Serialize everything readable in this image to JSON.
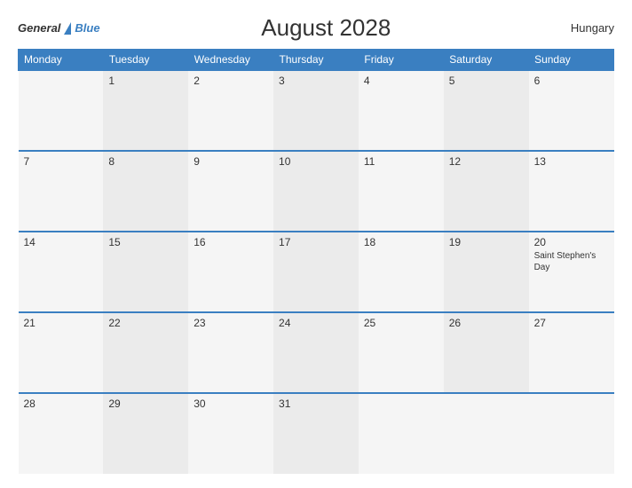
{
  "header": {
    "logo_general": "General",
    "logo_blue": "Blue",
    "title": "August 2028",
    "country": "Hungary"
  },
  "weekdays": [
    "Monday",
    "Tuesday",
    "Wednesday",
    "Thursday",
    "Friday",
    "Saturday",
    "Sunday"
  ],
  "weeks": [
    [
      {
        "day": "",
        "holiday": ""
      },
      {
        "day": "1",
        "holiday": ""
      },
      {
        "day": "2",
        "holiday": ""
      },
      {
        "day": "3",
        "holiday": ""
      },
      {
        "day": "4",
        "holiday": ""
      },
      {
        "day": "5",
        "holiday": ""
      },
      {
        "day": "6",
        "holiday": ""
      }
    ],
    [
      {
        "day": "7",
        "holiday": ""
      },
      {
        "day": "8",
        "holiday": ""
      },
      {
        "day": "9",
        "holiday": ""
      },
      {
        "day": "10",
        "holiday": ""
      },
      {
        "day": "11",
        "holiday": ""
      },
      {
        "day": "12",
        "holiday": ""
      },
      {
        "day": "13",
        "holiday": ""
      }
    ],
    [
      {
        "day": "14",
        "holiday": ""
      },
      {
        "day": "15",
        "holiday": ""
      },
      {
        "day": "16",
        "holiday": ""
      },
      {
        "day": "17",
        "holiday": ""
      },
      {
        "day": "18",
        "holiday": ""
      },
      {
        "day": "19",
        "holiday": ""
      },
      {
        "day": "20",
        "holiday": "Saint Stephen's Day"
      }
    ],
    [
      {
        "day": "21",
        "holiday": ""
      },
      {
        "day": "22",
        "holiday": ""
      },
      {
        "day": "23",
        "holiday": ""
      },
      {
        "day": "24",
        "holiday": ""
      },
      {
        "day": "25",
        "holiday": ""
      },
      {
        "day": "26",
        "holiday": ""
      },
      {
        "day": "27",
        "holiday": ""
      }
    ],
    [
      {
        "day": "28",
        "holiday": ""
      },
      {
        "day": "29",
        "holiday": ""
      },
      {
        "day": "30",
        "holiday": ""
      },
      {
        "day": "31",
        "holiday": ""
      },
      {
        "day": "",
        "holiday": ""
      },
      {
        "day": "",
        "holiday": ""
      },
      {
        "day": "",
        "holiday": ""
      }
    ]
  ]
}
